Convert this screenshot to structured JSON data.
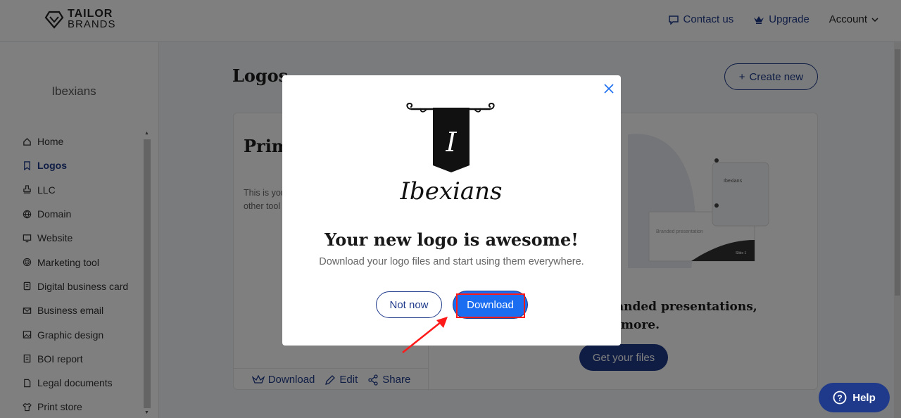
{
  "header": {
    "brand_line1": "TAILOR",
    "brand_line2": "BRANDS",
    "contact": "Contact us",
    "upgrade": "Upgrade",
    "account": "Account"
  },
  "sidebar": {
    "business_name": "Ibexians",
    "items": [
      {
        "label": "Home",
        "icon": "home-icon"
      },
      {
        "label": "Logos",
        "icon": "bookmark-icon",
        "active": true
      },
      {
        "label": "LLC",
        "icon": "stamp-icon"
      },
      {
        "label": "Domain",
        "icon": "globe-icon"
      },
      {
        "label": "Website",
        "icon": "monitor-icon"
      },
      {
        "label": "Marketing tool",
        "icon": "target-icon"
      },
      {
        "label": "Digital business card",
        "icon": "card-icon"
      },
      {
        "label": "Business email",
        "icon": "mail-icon"
      },
      {
        "label": "Graphic design",
        "icon": "image-icon"
      },
      {
        "label": "BOI report",
        "icon": "report-icon"
      },
      {
        "label": "Legal documents",
        "icon": "document-icon"
      },
      {
        "label": "Print store",
        "icon": "shirt-icon"
      }
    ]
  },
  "main": {
    "title": "Logos",
    "create_new": "Create new",
    "card": {
      "heading_partial": "Prim",
      "desc_line1": "This is you",
      "desc_line2": "other tool",
      "download": "Download",
      "edit": "Edit",
      "share": "Share",
      "promo_line1": "es, branded presentations,",
      "promo_line2": "more.",
      "get_files": "Get your files",
      "preview_name": "Ibexians",
      "preview_caption": "Branded presentation",
      "preview_slide": "Slide 1"
    }
  },
  "modal": {
    "logo_wordmark": "Ibexians",
    "logo_monogram": "I",
    "title": "Your new logo is awesome!",
    "subtitle": "Download your logo files and start using them everywhere.",
    "not_now": "Not now",
    "download": "Download"
  },
  "help": {
    "label": "Help"
  },
  "colors": {
    "brand_navy": "#1f3a8a",
    "primary_blue": "#1a6cf0",
    "annotation_red": "#ff1a1a"
  }
}
